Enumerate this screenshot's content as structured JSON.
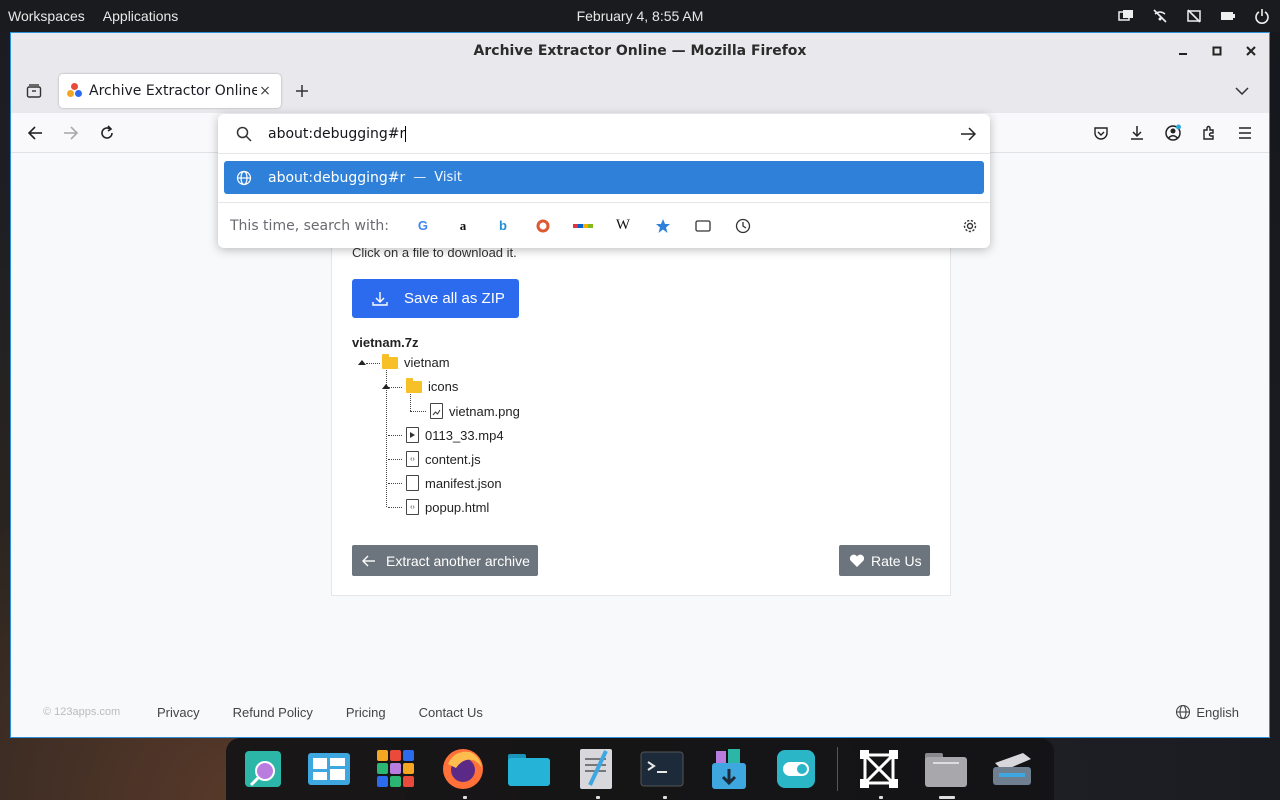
{
  "topbar": {
    "workspaces": "Workspaces",
    "applications": "Applications",
    "clock": "February 4, 8:55 AM"
  },
  "window": {
    "title": "Archive Extractor Online — Mozilla Firefox"
  },
  "tab": {
    "title": "Archive Extractor Online",
    "close": "×"
  },
  "urlbar": {
    "value": "about:debugging#r",
    "result_text": "about:debugging#r",
    "result_separator": "—",
    "result_action": "Visit",
    "search_label": "This time, search with:",
    "engines": [
      "google-icon",
      "amazon-icon",
      "bing-icon",
      "duckduckgo-icon",
      "ebay-icon",
      "wikipedia-icon",
      "bookmarks-icon",
      "tabs-icon",
      "history-icon"
    ]
  },
  "page": {
    "click_hint": "Click on a file to download it.",
    "zip_button": "Save all as ZIP",
    "archive_name": "vietnam.7z",
    "tree": [
      {
        "name": "vietnam",
        "type": "folder"
      },
      {
        "name": "icons",
        "type": "folder"
      },
      {
        "name": "vietnam.png",
        "type": "image"
      },
      {
        "name": "0113_33.mp4",
        "type": "video"
      },
      {
        "name": "content.js",
        "type": "code"
      },
      {
        "name": "manifest.json",
        "type": "file"
      },
      {
        "name": "popup.html",
        "type": "html"
      }
    ],
    "extract_another": "Extract another archive",
    "rate_us": "Rate Us"
  },
  "footer": {
    "brand": "© 123apps.com",
    "links": [
      "Privacy",
      "Refund Policy",
      "Pricing",
      "Contact Us"
    ],
    "language": "English"
  },
  "colors": {
    "accent": "#2c6bed",
    "result_highlight": "#2f80d8",
    "secondary_button": "#6c757d",
    "folder": "#f6c026"
  }
}
